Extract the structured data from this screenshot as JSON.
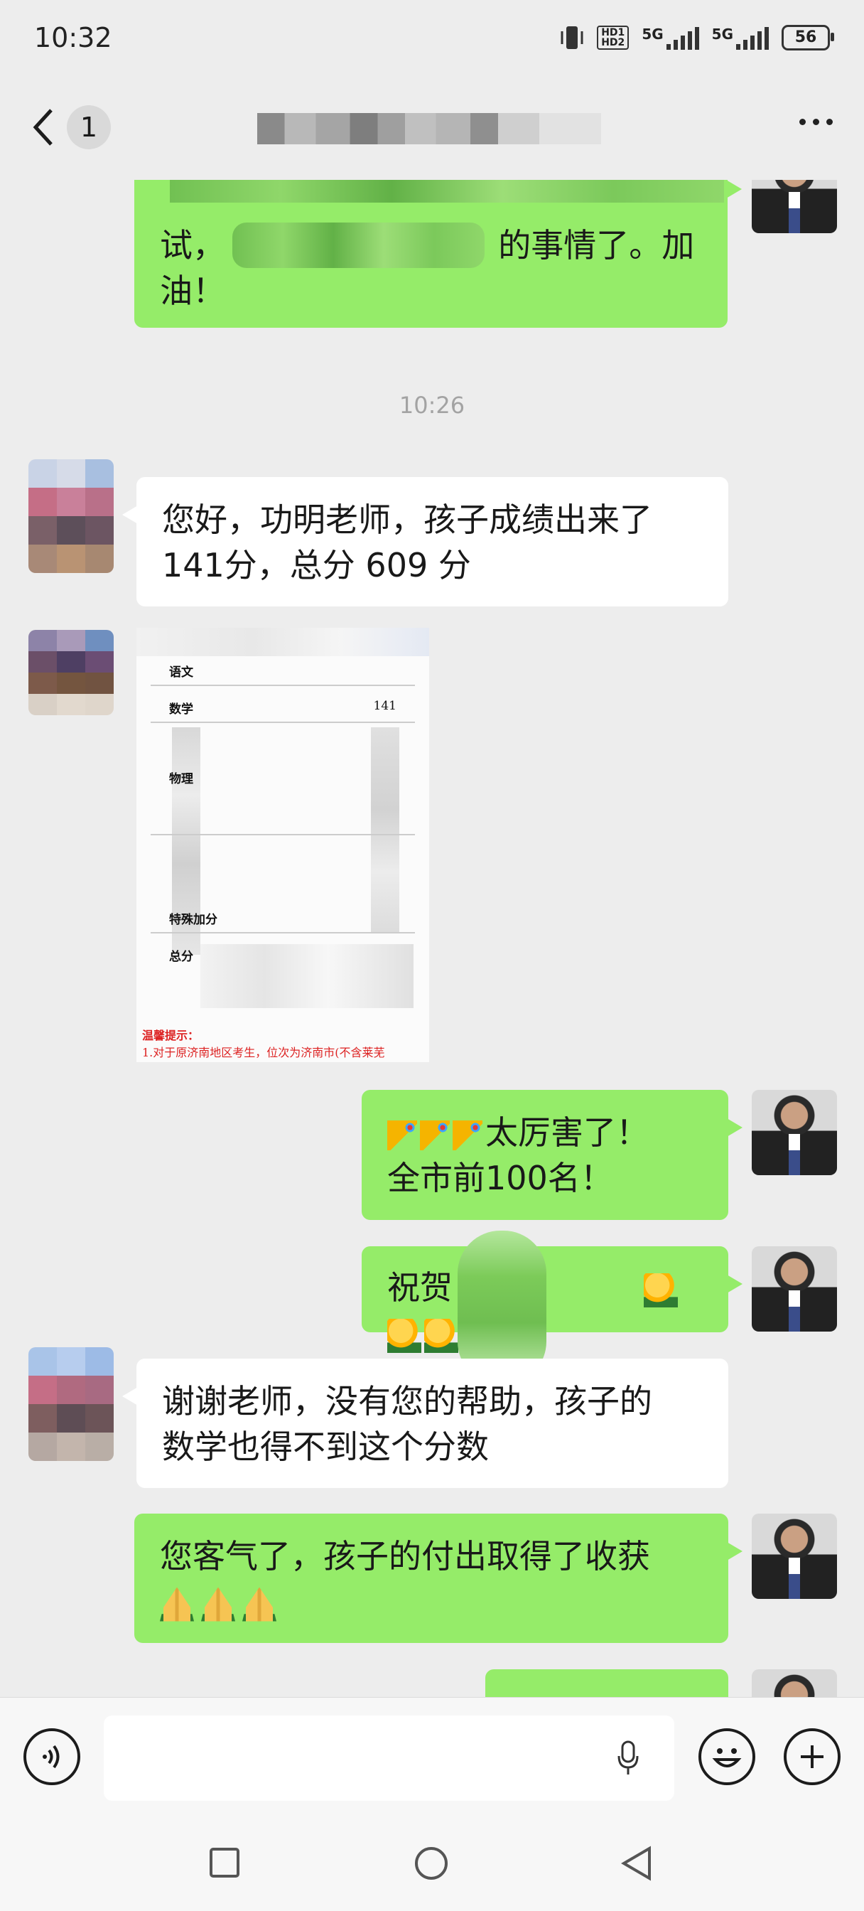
{
  "status_bar": {
    "time": "10:32",
    "network_1": "5G",
    "network_2": "5G",
    "hd_label": "HD1\nHD2",
    "battery": "56"
  },
  "header": {
    "unread_count": "1"
  },
  "messages": [
    {
      "sender": "me",
      "text_line1": "试，",
      "text_line1_tail": "的事情了。加",
      "text_line2": "油！"
    },
    {
      "type": "timestamp",
      "text": "10:26"
    },
    {
      "sender": "other",
      "text_line1": "您好，功明老师，孩子成绩出来了",
      "text_line2": "141分，总分 609 分"
    },
    {
      "sender": "other",
      "type": "image",
      "rows": [
        "语文",
        "数学",
        "物理",
        "特殊加分",
        "总分"
      ],
      "math_score": "141",
      "tip_title": "温馨提示：",
      "tip_text": "1.对于原济南地区考生，位次为济南市(不含莱芜"
    },
    {
      "sender": "me",
      "text_line1": "太厉害了！",
      "text_line2": "全市前100名！",
      "emoji": "party-popper"
    },
    {
      "sender": "me",
      "text": "祝贺",
      "emoji": "thumbs-up"
    },
    {
      "sender": "other",
      "text_line1": "谢谢老师，没有您的帮助，孩子的",
      "text_line2": "数学也得不到这个分数"
    },
    {
      "sender": "me",
      "text_line1": "您客气了，孩子的付出取得了收获",
      "emoji": "folded-hands"
    }
  ],
  "colors": {
    "bubble_mine": "#95ec69",
    "bubble_theirs": "#ffffff",
    "background": "#ededed"
  }
}
